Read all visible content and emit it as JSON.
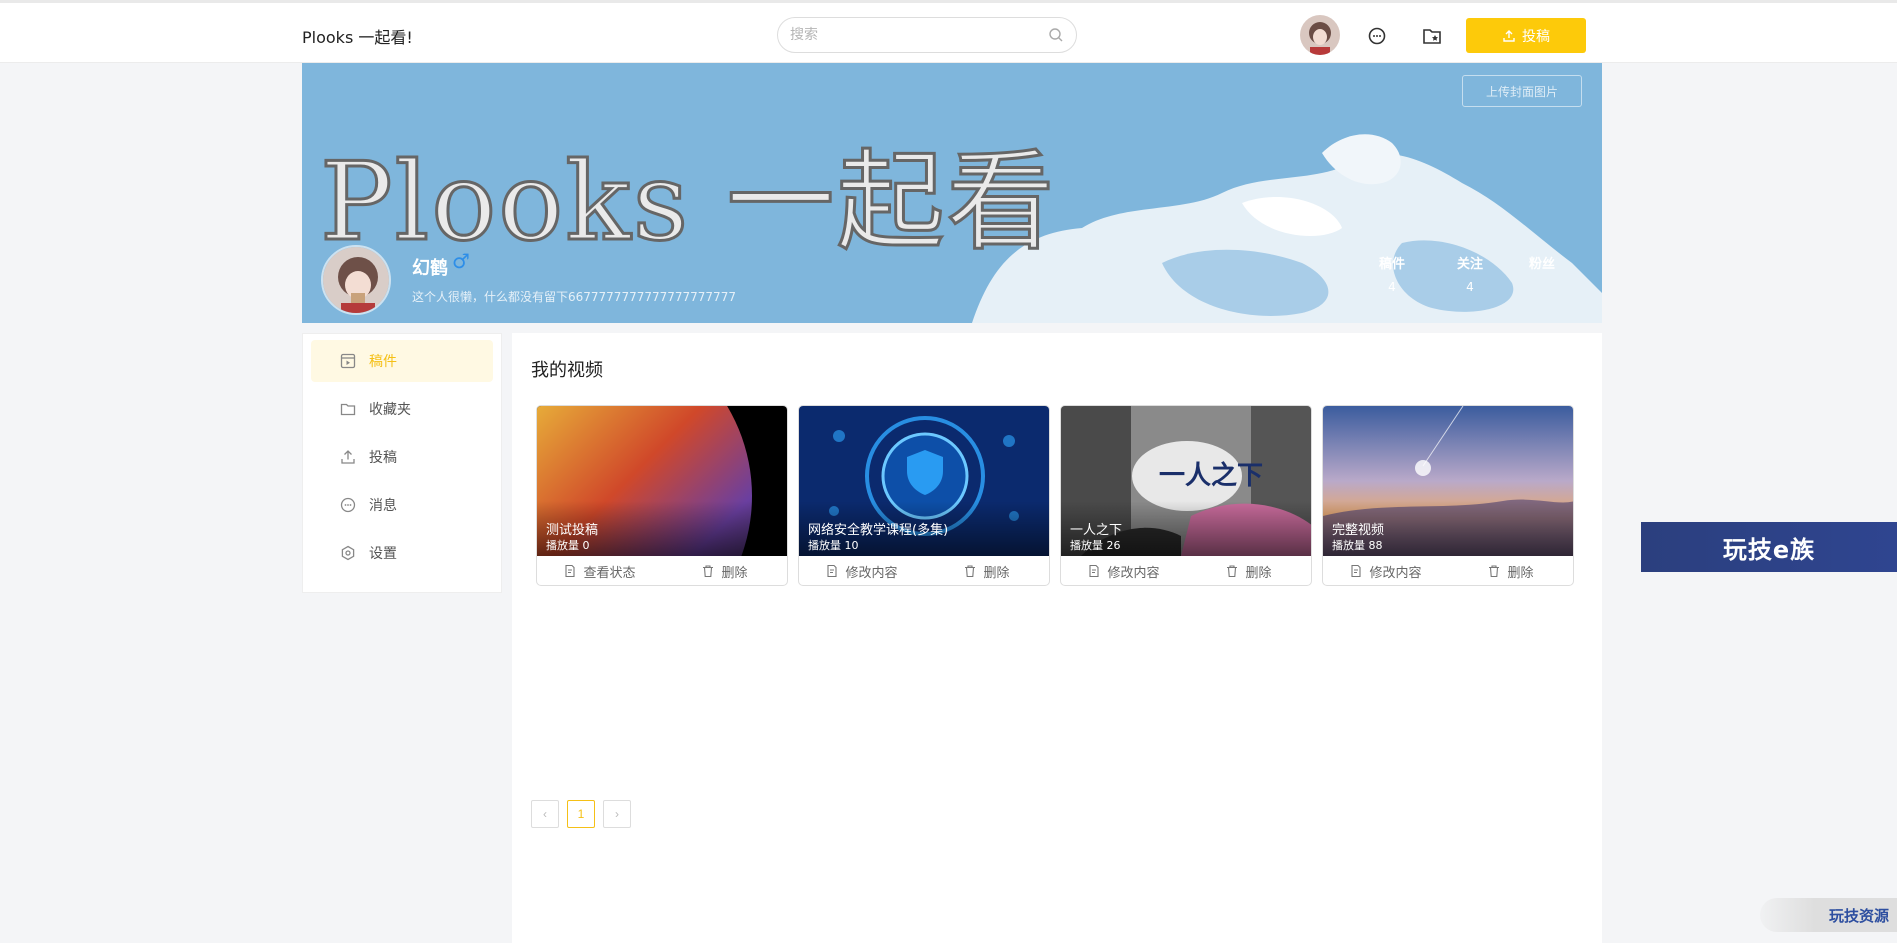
{
  "header": {
    "brand": "Plooks 一起看!",
    "search_placeholder": "搜索",
    "upload_label": "投稿"
  },
  "banner": {
    "title": "Plooks 一起看",
    "cover_button": "上传封面图片",
    "user": {
      "name": "幻鹤",
      "gender_symbol": "♂",
      "signature": "这个人很懒，什么都没有留下6677777777777777777777"
    },
    "stats": [
      {
        "label": "稿件",
        "value": "4"
      },
      {
        "label": "关注",
        "value": "4"
      },
      {
        "label": "粉丝",
        "value": ""
      }
    ]
  },
  "sidebar": {
    "items": [
      {
        "label": "稿件",
        "icon": "video-file-icon",
        "active": true
      },
      {
        "label": "收藏夹",
        "icon": "folder-icon",
        "active": false
      },
      {
        "label": "投稿",
        "icon": "upload-icon",
        "active": false
      },
      {
        "label": "消息",
        "icon": "message-icon",
        "active": false
      },
      {
        "label": "设置",
        "icon": "settings-icon",
        "active": false
      }
    ]
  },
  "main": {
    "section_title": "我的视频",
    "videos": [
      {
        "title": "测试投稿",
        "plays": "播放量  0",
        "left_action": "查看状态",
        "right_action": "删除"
      },
      {
        "title": "网络安全教学课程(多集)",
        "plays": "播放量  10",
        "left_action": "修改内容",
        "right_action": "删除"
      },
      {
        "title": "一人之下",
        "plays": "播放量  26",
        "left_action": "修改内容",
        "right_action": "删除"
      },
      {
        "title": "完整视频",
        "plays": "播放量  88",
        "left_action": "修改内容",
        "right_action": "删除"
      }
    ],
    "pagination": {
      "prev": "‹",
      "current": "1",
      "next": "›"
    }
  },
  "watermarks": {
    "side": "玩技e族",
    "corner": "玩技资源"
  },
  "colors": {
    "accent": "#fdca0a",
    "banner_bg": "#7fb6dc",
    "gender": "#2d8ee8"
  }
}
